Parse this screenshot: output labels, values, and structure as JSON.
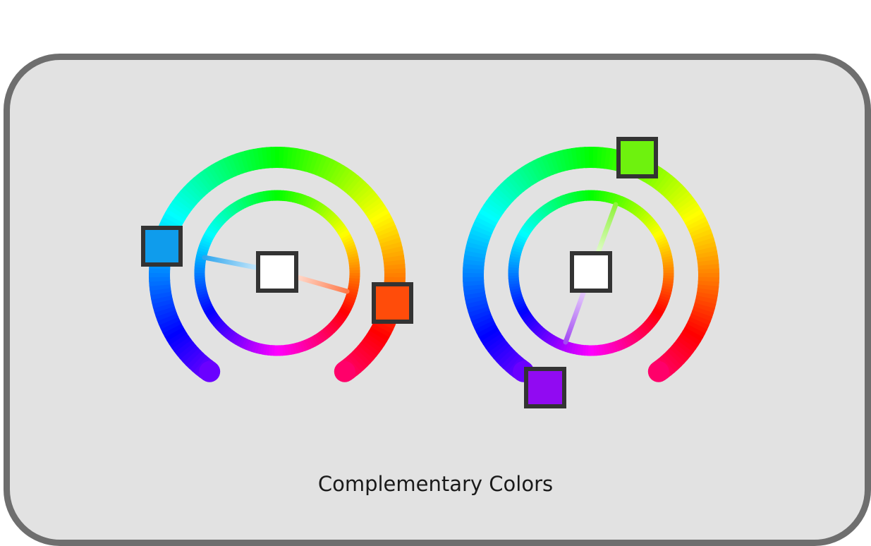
{
  "caption": "Complementary Colors",
  "colors": {
    "panel_background": "#e2e2e2",
    "panel_border": "#6e6e6e",
    "handle_border": "#333333",
    "center_square": "#ffffff"
  },
  "wheels": [
    {
      "name": "left-wheel",
      "selected_colors": [
        {
          "role": "primary",
          "hex": "#0f9cec",
          "hue_deg": 202
        },
        {
          "role": "complement",
          "hex": "#ff4c0a",
          "hue_deg": 16
        }
      ]
    },
    {
      "name": "right-wheel",
      "selected_colors": [
        {
          "role": "primary",
          "hex": "#6ef20e",
          "hue_deg": 95
        },
        {
          "role": "complement",
          "hex": "#910af2",
          "hue_deg": 275
        }
      ]
    }
  ],
  "icons": {
    "outer_ring": "hue-arc-icon",
    "inner_ring": "hue-ring-icon",
    "center": "center-square-icon"
  }
}
